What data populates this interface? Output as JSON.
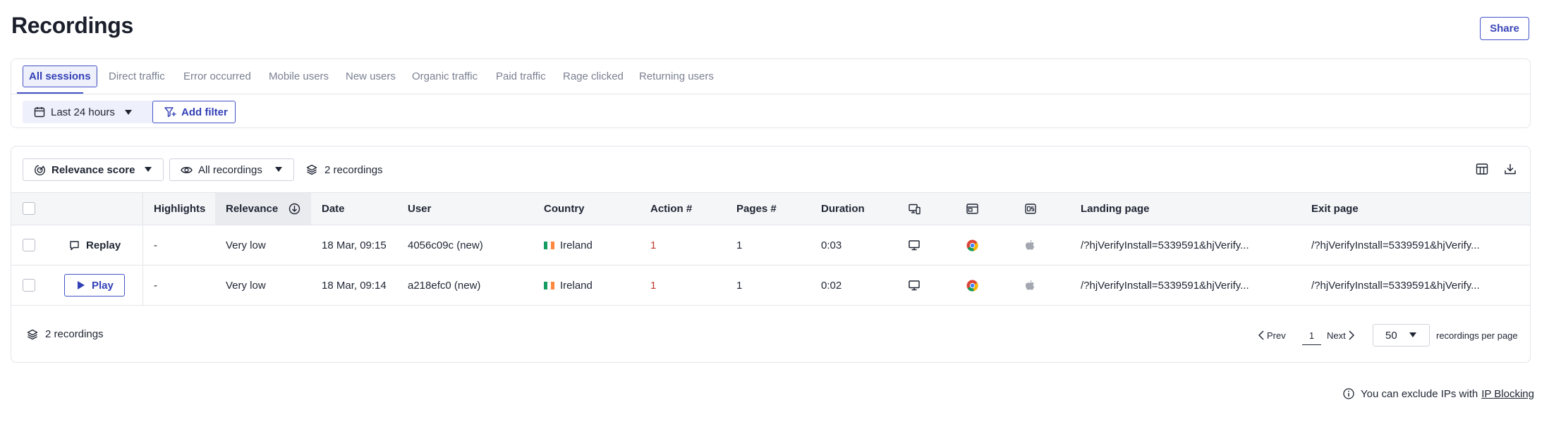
{
  "header": {
    "title": "Recordings",
    "share_label": "Share"
  },
  "segments": {
    "tabs": [
      {
        "label": "All sessions",
        "active": true
      },
      {
        "label": "Direct traffic"
      },
      {
        "label": "Error occurred"
      },
      {
        "label": "Mobile users"
      },
      {
        "label": "New users"
      },
      {
        "label": "Organic traffic"
      },
      {
        "label": "Paid traffic"
      },
      {
        "label": "Rage clicked"
      },
      {
        "label": "Returning users"
      }
    ]
  },
  "filters": {
    "date_label": "Last 24 hours",
    "add_filter_label": "Add filter"
  },
  "toolbar": {
    "sort_label": "Relevance score",
    "recordings_filter_label": "All recordings",
    "count_label": "2 recordings"
  },
  "table": {
    "columns": {
      "highlights": "Highlights",
      "relevance": "Relevance",
      "date": "Date",
      "user": "User",
      "country": "Country",
      "actions": "Action #",
      "pages": "Pages #",
      "duration": "Duration",
      "device": "device-icon",
      "browser": "browser-icon",
      "os": "os-icon",
      "landing": "Landing page",
      "exit": "Exit page"
    },
    "rows": [
      {
        "button_label": "Replay",
        "highlights": "-",
        "relevance": "Very low",
        "date": "18 Mar, 09:15",
        "user": "4056c09c (new)",
        "country": "Ireland",
        "actions": "1",
        "pages": "1",
        "duration": "0:03",
        "landing": "/?hjVerifyInstall=5339591&hjVerify...",
        "exit": "/?hjVerifyInstall=5339591&hjVerify..."
      },
      {
        "button_label": "Play",
        "highlights": "-",
        "relevance": "Very low",
        "date": "18 Mar, 09:14",
        "user": "a218efc0 (new)",
        "country": "Ireland",
        "actions": "1",
        "pages": "1",
        "duration": "0:02",
        "landing": "/?hjVerifyInstall=5339591&hjVerify...",
        "exit": "/?hjVerifyInstall=5339591&hjVerify..."
      }
    ]
  },
  "footer": {
    "count_label": "2 recordings",
    "prev_label": "Prev",
    "page_number": "1",
    "next_label": "Next",
    "per_page_value": "50",
    "per_page_label": "recordings per page"
  },
  "note": {
    "text": "You can exclude IPs with",
    "link_label": "IP Blocking"
  },
  "colors": {
    "accent": "#4453c8",
    "action_number": "#c0392b",
    "flag_ireland": [
      "#169b62",
      "#ffffff",
      "#ff883e"
    ]
  }
}
